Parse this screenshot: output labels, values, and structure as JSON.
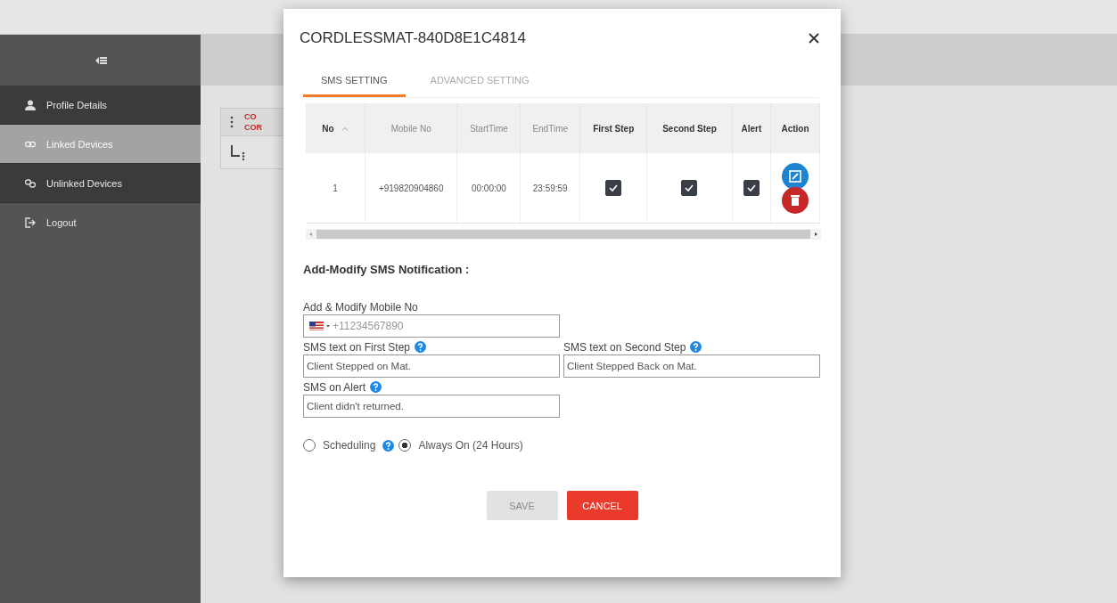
{
  "sidebar": {
    "items": [
      {
        "label": "Profile Details",
        "kind": "nav",
        "selected": false
      },
      {
        "label": "Linked Devices",
        "kind": "nav",
        "selected": true
      },
      {
        "label": "Unlinked Devices",
        "kind": "nav",
        "selected": false
      },
      {
        "label": "Logout",
        "kind": "action",
        "selected": false
      }
    ]
  },
  "device_card": {
    "lines": [
      "CO",
      "COR"
    ]
  },
  "dialog": {
    "title": "CORDLESSMAT-840D8E1C4814",
    "tabs": [
      {
        "label": "SMS SETTING",
        "selected": true
      },
      {
        "label": "ADVANCED SETTING",
        "selected": false
      }
    ],
    "table": {
      "columns": [
        {
          "label": "No",
          "kind": "key",
          "sorted": true
        },
        {
          "label": "Mobile No",
          "kind": "text"
        },
        {
          "label": "StartTime",
          "kind": "text"
        },
        {
          "label": "EndTime",
          "kind": "text"
        },
        {
          "label": "First Step",
          "kind": "check"
        },
        {
          "label": "Second Step",
          "kind": "check"
        },
        {
          "label": "Alert",
          "kind": "check"
        },
        {
          "label": "Action",
          "kind": "action"
        }
      ],
      "rows": [
        {
          "no": "1",
          "mobile": "+919820904860",
          "start": "00:00:00",
          "end": "23:59:59",
          "first_step": true,
          "second_step": true,
          "alert": true
        }
      ]
    },
    "form": {
      "heading": "Add-Modify SMS Notification :",
      "fields": [
        {
          "kind": "phone",
          "label": "Add & Modify Mobile No",
          "placeholder": "+11234567890",
          "help": false
        },
        {
          "kind": "text",
          "label": "SMS text on First Step",
          "value": "Client Stepped on Mat.",
          "help": true
        },
        {
          "kind": "text",
          "label": "SMS text on Second Step",
          "value": "Client Stepped Back on Mat.",
          "help": true
        },
        {
          "kind": "text",
          "label": "SMS on Alert",
          "value": "Client didn't returned.",
          "help": true
        }
      ],
      "radios": [
        {
          "label": "Scheduling",
          "selected": false,
          "help": true
        },
        {
          "label": "Always On (24 Hours)",
          "selected": true,
          "help": false
        }
      ]
    },
    "buttons": [
      {
        "label": "SAVE",
        "kind": "primary",
        "disabled": true
      },
      {
        "label": "CANCEL",
        "kind": "danger",
        "disabled": false
      }
    ]
  }
}
